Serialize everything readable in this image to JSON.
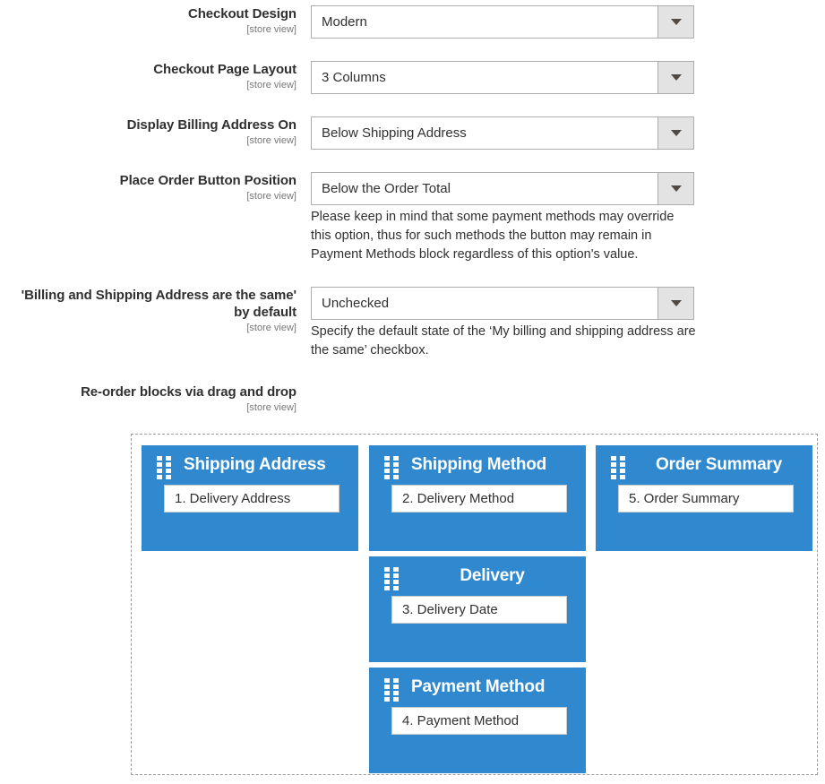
{
  "theme": {
    "block_blue": "#3089cf",
    "text_color": "#303030",
    "scope_color": "#777777",
    "select_border": "#adadad",
    "select_button_bg": "#e3e3e3",
    "dashed_border": "#9a9a9a"
  },
  "scope_note": "[store view]",
  "fields": [
    {
      "label": "Checkout Design",
      "scope": "[store view]",
      "value": "Modern",
      "icon": "chevron-down-icon"
    },
    {
      "label": "Checkout Page Layout",
      "scope": "[store view]",
      "value": "3 Columns",
      "icon": "chevron-down-icon"
    },
    {
      "label": "Display Billing Address On",
      "scope": "[store view]",
      "value": "Below Shipping Address",
      "icon": "chevron-down-icon"
    },
    {
      "label": "Place Order Button Position",
      "scope": "[store view]",
      "value": "Below the Order Total",
      "icon": "chevron-down-icon",
      "note": "Please keep in mind that some payment methods may override this option, thus for such methods the button may remain in Payment Methods block regardless of this option's value."
    },
    {
      "label_line_1": "'Billing and Shipping Address are the same'",
      "label_line_2": "by default",
      "scope": "[store view]",
      "value": "Unchecked",
      "icon": "chevron-down-icon",
      "note": "Specify the default state of the ‘My billing and shipping address are the same’ checkbox."
    }
  ],
  "reorder": {
    "label": "Re-order blocks via drag and drop",
    "scope": "[store view]",
    "blocks": [
      {
        "title": "Shipping Address",
        "item": "1. Delivery Address",
        "title_align": "left",
        "handle": "drag-handle-icon"
      },
      {
        "title": "Shipping Method",
        "item": "2. Delivery Method",
        "title_align": "left",
        "handle": "drag-handle-icon"
      },
      {
        "title": "Order Summary",
        "item": "5. Order Summary",
        "title_align": "center",
        "handle": "drag-handle-icon"
      },
      {
        "title": "Delivery",
        "item": "3. Delivery Date",
        "title_align": "center",
        "handle": "drag-handle-icon"
      },
      {
        "title": "Payment Method",
        "item": "4. Payment Method",
        "title_align": "left",
        "handle": "drag-handle-icon"
      }
    ]
  }
}
